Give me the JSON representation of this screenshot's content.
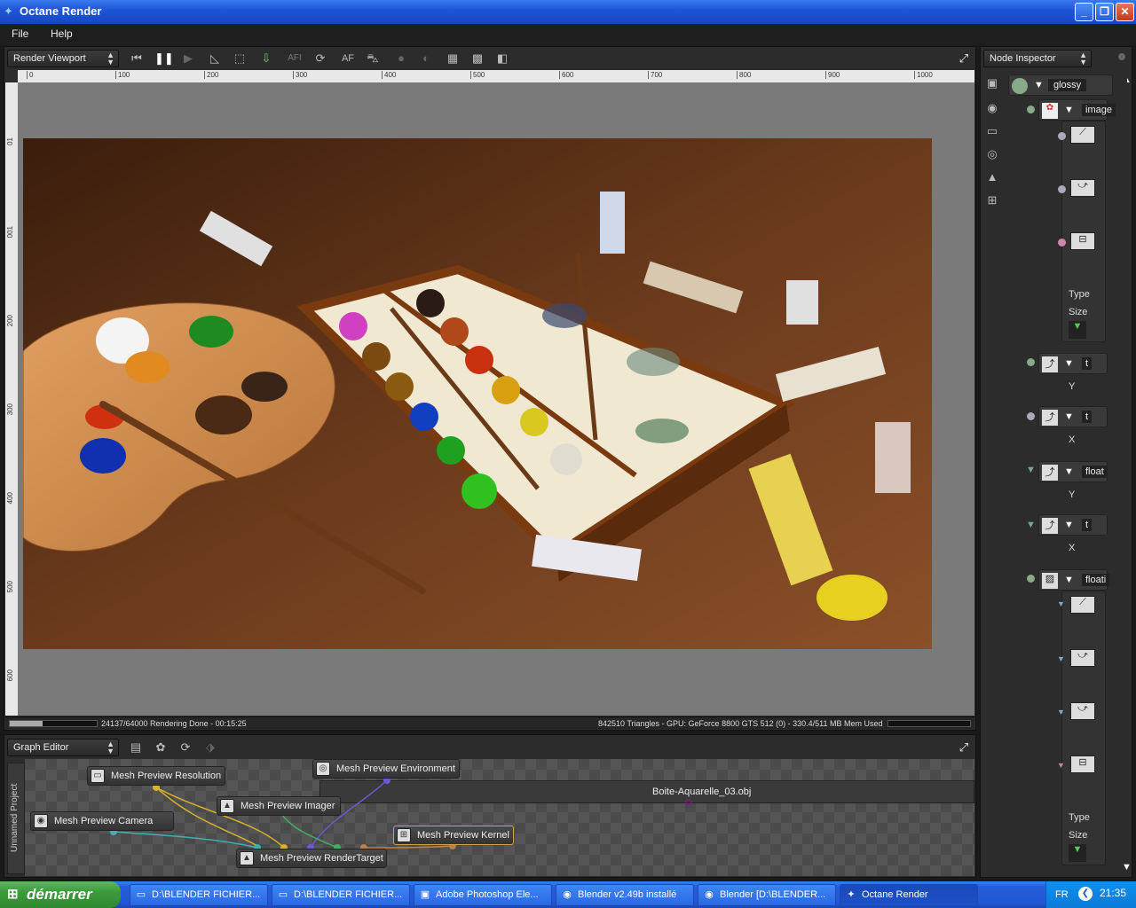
{
  "window": {
    "title": "Octane Render",
    "min_icon": "minimize-icon",
    "max_icon": "maximize-icon",
    "close_icon": "close-icon"
  },
  "menu": {
    "file": "File",
    "help": "Help"
  },
  "viewport_toolbar": {
    "mode": "Render Viewport",
    "af_label": "AF",
    "afi_label": "AFI"
  },
  "ruler": {
    "h_ticks": [
      "0",
      "100",
      "200",
      "300",
      "400",
      "500",
      "600",
      "700",
      "800",
      "900",
      "1000"
    ],
    "v_ticks": [
      "01",
      "001",
      "200",
      "300",
      "400",
      "500",
      "600"
    ]
  },
  "status": {
    "left": "24137/64000 Rendering Done - 00:15:25",
    "right": "842510 Triangles - GPU: GeForce 8800 GTS 512 (0) - 330.4/511 MB Mem Used",
    "progress": 0.377
  },
  "graph": {
    "mode": "Graph Editor",
    "project_label": "Unnamed Project",
    "mesh_label": "Boite-Aquarelle_03.obj",
    "nodes": {
      "resolution": "Mesh Preview Resolution",
      "environment": "Mesh Preview Environment",
      "imager": "Mesh Preview Imager",
      "camera": "Mesh Preview Camera",
      "kernel": "Mesh Preview Kernel",
      "rendertarget": "Mesh Preview RenderTarget"
    }
  },
  "inspector": {
    "mode": "Node Inspector",
    "material": "glossy",
    "image_label": "image",
    "float_labels": [
      "float",
      "floati"
    ],
    "small_labels": [
      "t",
      "t",
      "t"
    ],
    "type_label": "Type",
    "size_label": "Size",
    "y_label": "Y",
    "x_label": "X"
  },
  "taskbar": {
    "start": "démarrer",
    "tasks": [
      "D:\\BLENDER FICHIER...",
      "D:\\BLENDER FICHIER...",
      "Adobe Photoshop Ele...",
      "Blender v2.49b installé",
      "Blender [D:\\BLENDER...",
      "Octane Render"
    ],
    "lang": "FR",
    "time": "21:35"
  },
  "colors": {
    "accent": "#2157d4",
    "node_selected": "#c9a24a",
    "render_bg": "#4a2a14"
  }
}
